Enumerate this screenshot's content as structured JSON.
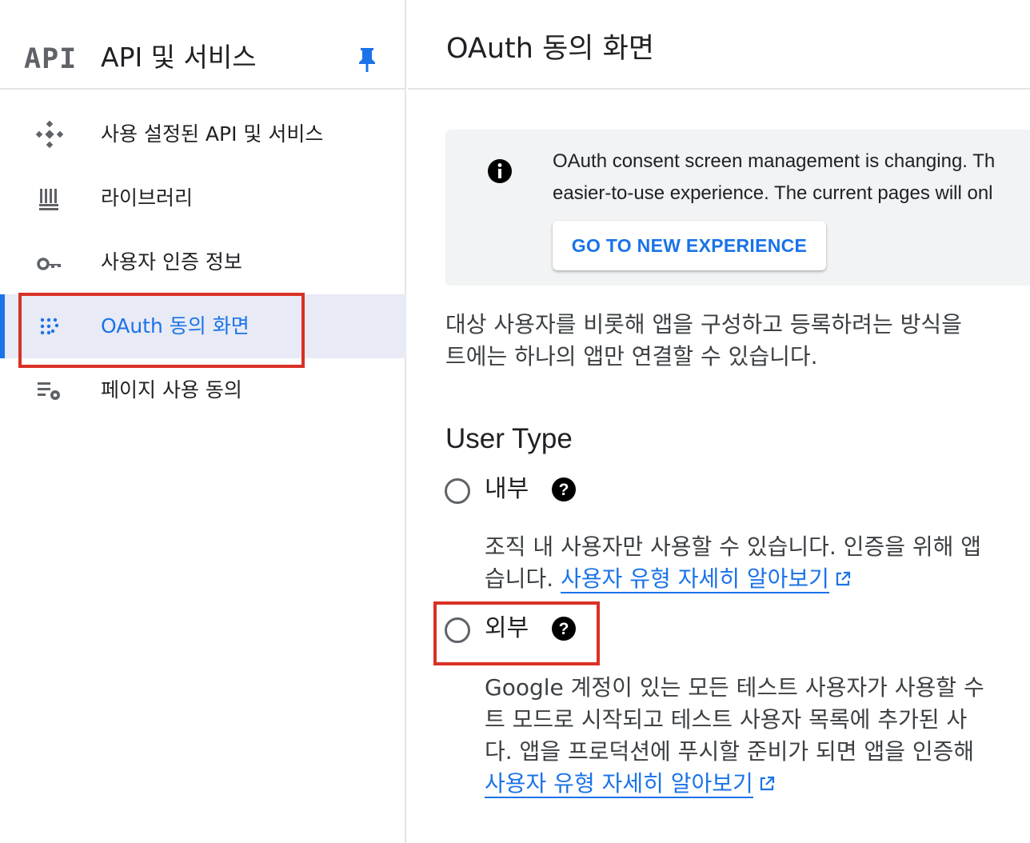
{
  "sidebar": {
    "logo": "API",
    "title": "API 및 서비스",
    "items": [
      {
        "label": "사용 설정된 API 및 서비스",
        "icon": "api-services-icon"
      },
      {
        "label": "라이브러리",
        "icon": "library-icon"
      },
      {
        "label": "사용자 인증 정보",
        "icon": "key-icon"
      },
      {
        "label": "OAuth 동의 화면",
        "icon": "oauth-consent-icon",
        "active": true
      },
      {
        "label": "페이지 사용 동의",
        "icon": "page-settings-icon"
      }
    ]
  },
  "main": {
    "title": "OAuth 동의 화면",
    "banner": {
      "line1": "OAuth consent screen management is changing. Th",
      "line2": "easier-to-use experience. The current pages will onl",
      "button": "GO TO NEW EXPERIENCE"
    },
    "description": {
      "line1": "대상 사용자를 비롯해 앱을 구성하고 등록하려는 방식을",
      "line2": "트에는 하나의 앱만 연결할 수 있습니다."
    },
    "user_type": {
      "heading": "User Type",
      "internal": {
        "label": "내부",
        "line1": "조직 내 사용자만 사용할 수 있습니다. 인증을 위해 앱",
        "line2_prefix": "습니다. ",
        "link": "사용자 유형 자세히 알아보기"
      },
      "external": {
        "label": "외부",
        "line1": "Google 계정이 있는 모든 테스트 사용자가 사용할 수",
        "line2": "트 모드로 시작되고 테스트 사용자 목록에 추가된 사",
        "line3": "다. 앱을 프로덕션에 푸시할 준비가 되면 앱을 인증해",
        "link": "사용자 유형 자세히 알아보기"
      }
    }
  },
  "colors": {
    "accent": "#1a73e8",
    "highlight": "#d93025",
    "active_bg": "#e8eaf6"
  }
}
